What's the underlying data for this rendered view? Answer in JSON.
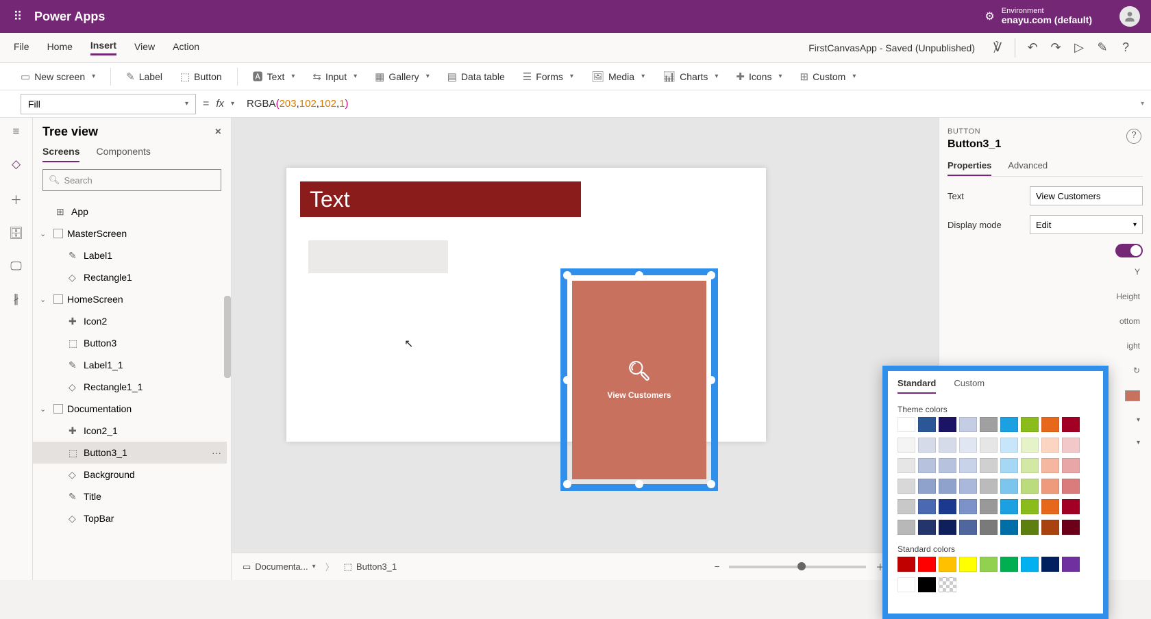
{
  "header": {
    "brand": "Power Apps",
    "env_label": "Environment",
    "env_value": "enayu.com (default)"
  },
  "menu": {
    "items": [
      "File",
      "Home",
      "Insert",
      "View",
      "Action"
    ],
    "active": "Insert",
    "status": "FirstCanvasApp - Saved (Unpublished)"
  },
  "ribbon": {
    "new_screen": "New screen",
    "label": "Label",
    "button": "Button",
    "text": "Text",
    "input": "Input",
    "gallery": "Gallery",
    "data_table": "Data table",
    "forms": "Forms",
    "media": "Media",
    "charts": "Charts",
    "icons": "Icons",
    "custom": "Custom"
  },
  "formula": {
    "property": "Fill",
    "tokens": [
      "RGBA",
      "(",
      "203",
      ", ",
      "102",
      ", ",
      "102",
      ", ",
      "1",
      ")"
    ]
  },
  "treeview": {
    "title": "Tree view",
    "tabs": {
      "screens": "Screens",
      "components": "Components"
    },
    "search_placeholder": "Search",
    "app": "App",
    "items": [
      {
        "name": "MasterScreen",
        "children": [
          "Label1",
          "Rectangle1"
        ]
      },
      {
        "name": "HomeScreen",
        "children": [
          "Icon2",
          "Button3",
          "Label1_1",
          "Rectangle1_1"
        ]
      },
      {
        "name": "Documentation",
        "children": [
          "Icon2_1",
          "Button3_1",
          "Background",
          "Title",
          "TopBar"
        ]
      }
    ],
    "selected": "Button3_1"
  },
  "canvas": {
    "label_text": "Text",
    "button_text": "View Customers"
  },
  "properties": {
    "type_label": "BUTTON",
    "name": "Button3_1",
    "tabs": {
      "properties": "Properties",
      "advanced": "Advanced"
    },
    "text_label": "Text",
    "text_value": "View Customers",
    "displaymode_label": "Display mode",
    "displaymode_value": "Edit",
    "hidden_labels": [
      "Y",
      "Height",
      "ottom",
      "ight"
    ]
  },
  "colorpicker": {
    "tabs": {
      "standard": "Standard",
      "custom": "Custom"
    },
    "section_theme": "Theme colors",
    "section_standard": "Standard colors",
    "theme_rows": [
      [
        "#ffffff",
        "#2b5797",
        "#1b1464",
        "#c4cde3",
        "#a0a0a0",
        "#1ba1e2",
        "#8abd1b",
        "#e8681b",
        "#a20025"
      ],
      [
        "#f4f4f4",
        "#d6dbea",
        "#d6dbea",
        "#e0e6f2",
        "#e6e6e6",
        "#c8e6fa",
        "#e6f2c8",
        "#fbd4c2",
        "#f2c8c8"
      ],
      [
        "#e6e6e6",
        "#b6c2de",
        "#b6c2de",
        "#c8d2e8",
        "#d0d0d0",
        "#a6d8f5",
        "#d4e8a6",
        "#f5b7a0",
        "#e8a6a6"
      ],
      [
        "#d8d8d8",
        "#8fa2cc",
        "#8fa2cc",
        "#aab8db",
        "#bbbbbb",
        "#7cc6ee",
        "#bcdb7c",
        "#ee9a7c",
        "#db7c7c"
      ],
      [
        "#c8c8c8",
        "#4a69b2",
        "#1b3a8f",
        "#7c92c8",
        "#999999",
        "#1ba1e2",
        "#8abd1b",
        "#e8681b",
        "#a20025"
      ],
      [
        "#b8b8b8",
        "#24356b",
        "#0f1f5c",
        "#50679e",
        "#7a7a7a",
        "#006fa8",
        "#5c7f0f",
        "#a8430f",
        "#6b0018"
      ]
    ],
    "standard_rows": [
      [
        "#c00000",
        "#ff0000",
        "#ffc000",
        "#ffff00",
        "#92d050",
        "#00b050",
        "#00b0f0",
        "#002060",
        "#7030a0"
      ],
      [
        "#ffffff",
        "#000000",
        "transparent"
      ]
    ]
  },
  "statusbar": {
    "crumb1": "Documenta...",
    "crumb2": "Button3_1",
    "zoom": "50",
    "zoom_suffix": "%"
  }
}
